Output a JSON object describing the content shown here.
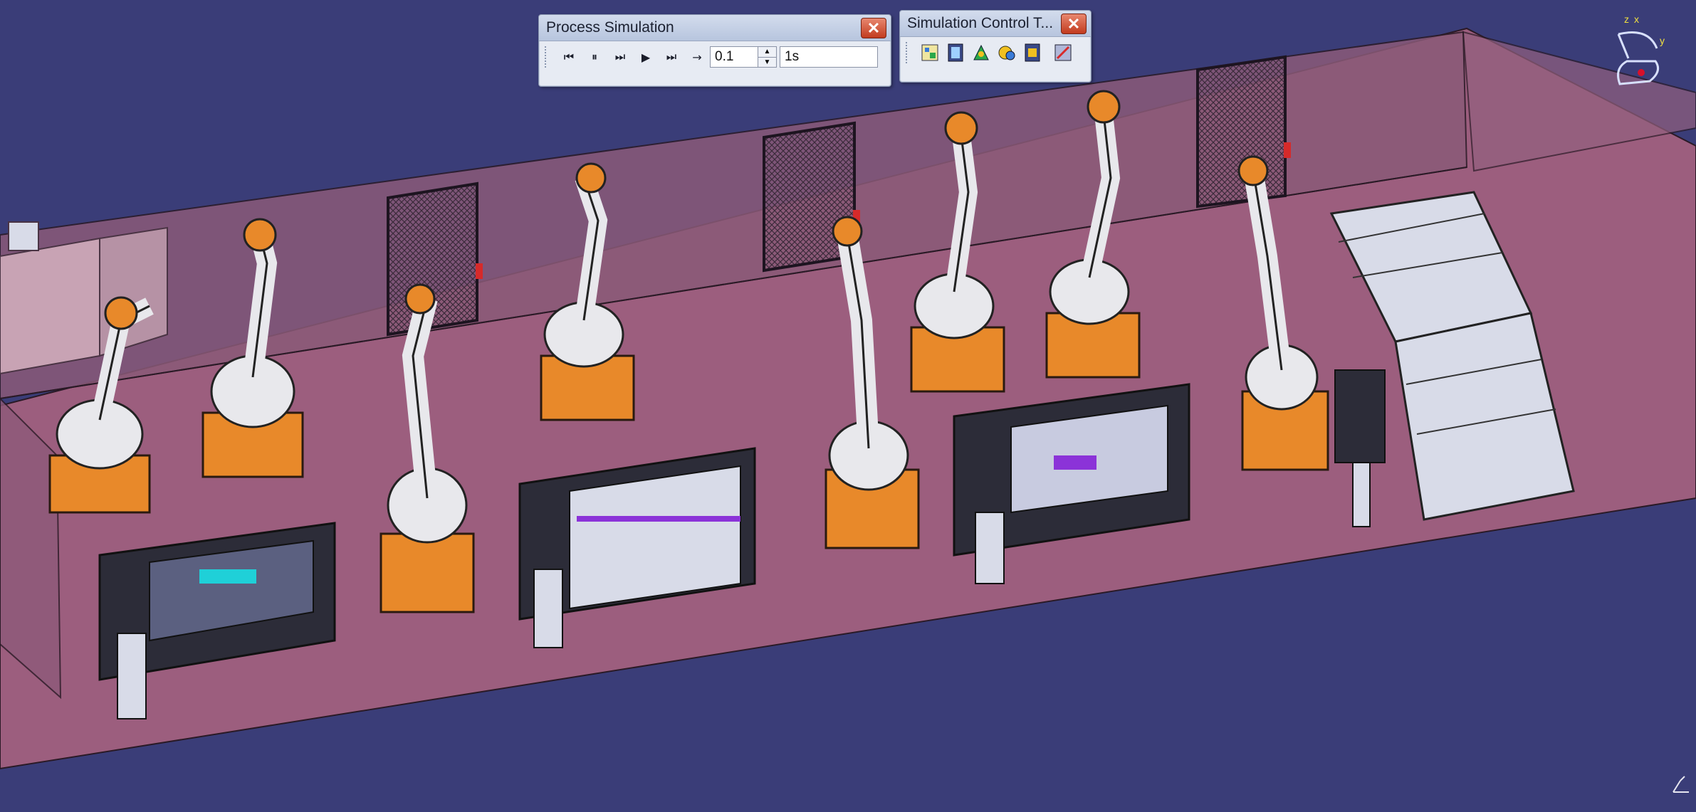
{
  "windows": {
    "process_simulation": {
      "title": "Process Simulation",
      "close_glyph": "✕",
      "step_value": "0.1",
      "duration_value": "1s",
      "buttons": [
        {
          "name": "jump-to-start-icon",
          "glyph": "⏮"
        },
        {
          "name": "pause-icon",
          "glyph": "⏸"
        },
        {
          "name": "step-forward-icon",
          "glyph": "⏭"
        },
        {
          "name": "play-icon",
          "glyph": "▶"
        },
        {
          "name": "jump-to-end-icon",
          "glyph": "⏭"
        },
        {
          "name": "step-mode-arrow-icon",
          "glyph": "→"
        }
      ]
    },
    "simulation_control": {
      "title": "Simulation Control T...",
      "close_glyph": "✕",
      "icons": [
        "simulation-tree-icon",
        "film-strip-icon",
        "sequence-editor-icon",
        "clash-detection-icon",
        "record-track-icon",
        "player-settings-icon"
      ]
    }
  },
  "compass": {
    "axis_x": "x",
    "axis_y": "y",
    "axis_z": "z",
    "accent": "#d8e0ff",
    "pointer": "#d8102a"
  },
  "colors": {
    "background": "#3a3d78",
    "floor": "#9c5e7e",
    "wall": "#8a5a78",
    "robot_orange": "#e8892a",
    "robot_white": "#e8e8ec"
  }
}
